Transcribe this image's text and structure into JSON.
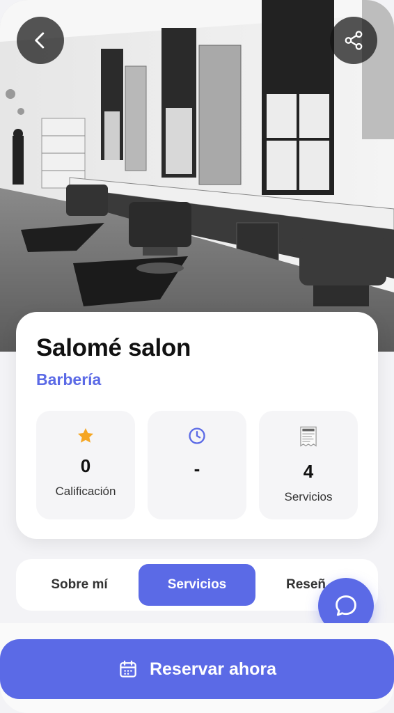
{
  "salon": {
    "name": "Salomé salon",
    "category": "Barbería"
  },
  "stats": [
    {
      "icon": "star-icon",
      "value": "0",
      "label": "Calificación"
    },
    {
      "icon": "clock-icon",
      "value": "-",
      "label": ""
    },
    {
      "icon": "receipt-icon",
      "value": "4",
      "label": "Servicios"
    }
  ],
  "tabs": [
    {
      "label": "Sobre mí",
      "active": false
    },
    {
      "label": "Servicios",
      "active": true
    },
    {
      "label": "Reseñ",
      "active": false
    }
  ],
  "actions": {
    "back_icon": "back-arrow-icon",
    "share_icon": "share-icon",
    "chat_icon": "chat-bubble-icon",
    "reserve_label": "Reservar ahora",
    "reserve_icon": "calendar-icon"
  },
  "colors": {
    "accent": "#5b6ae6",
    "star": "#f5a623"
  }
}
